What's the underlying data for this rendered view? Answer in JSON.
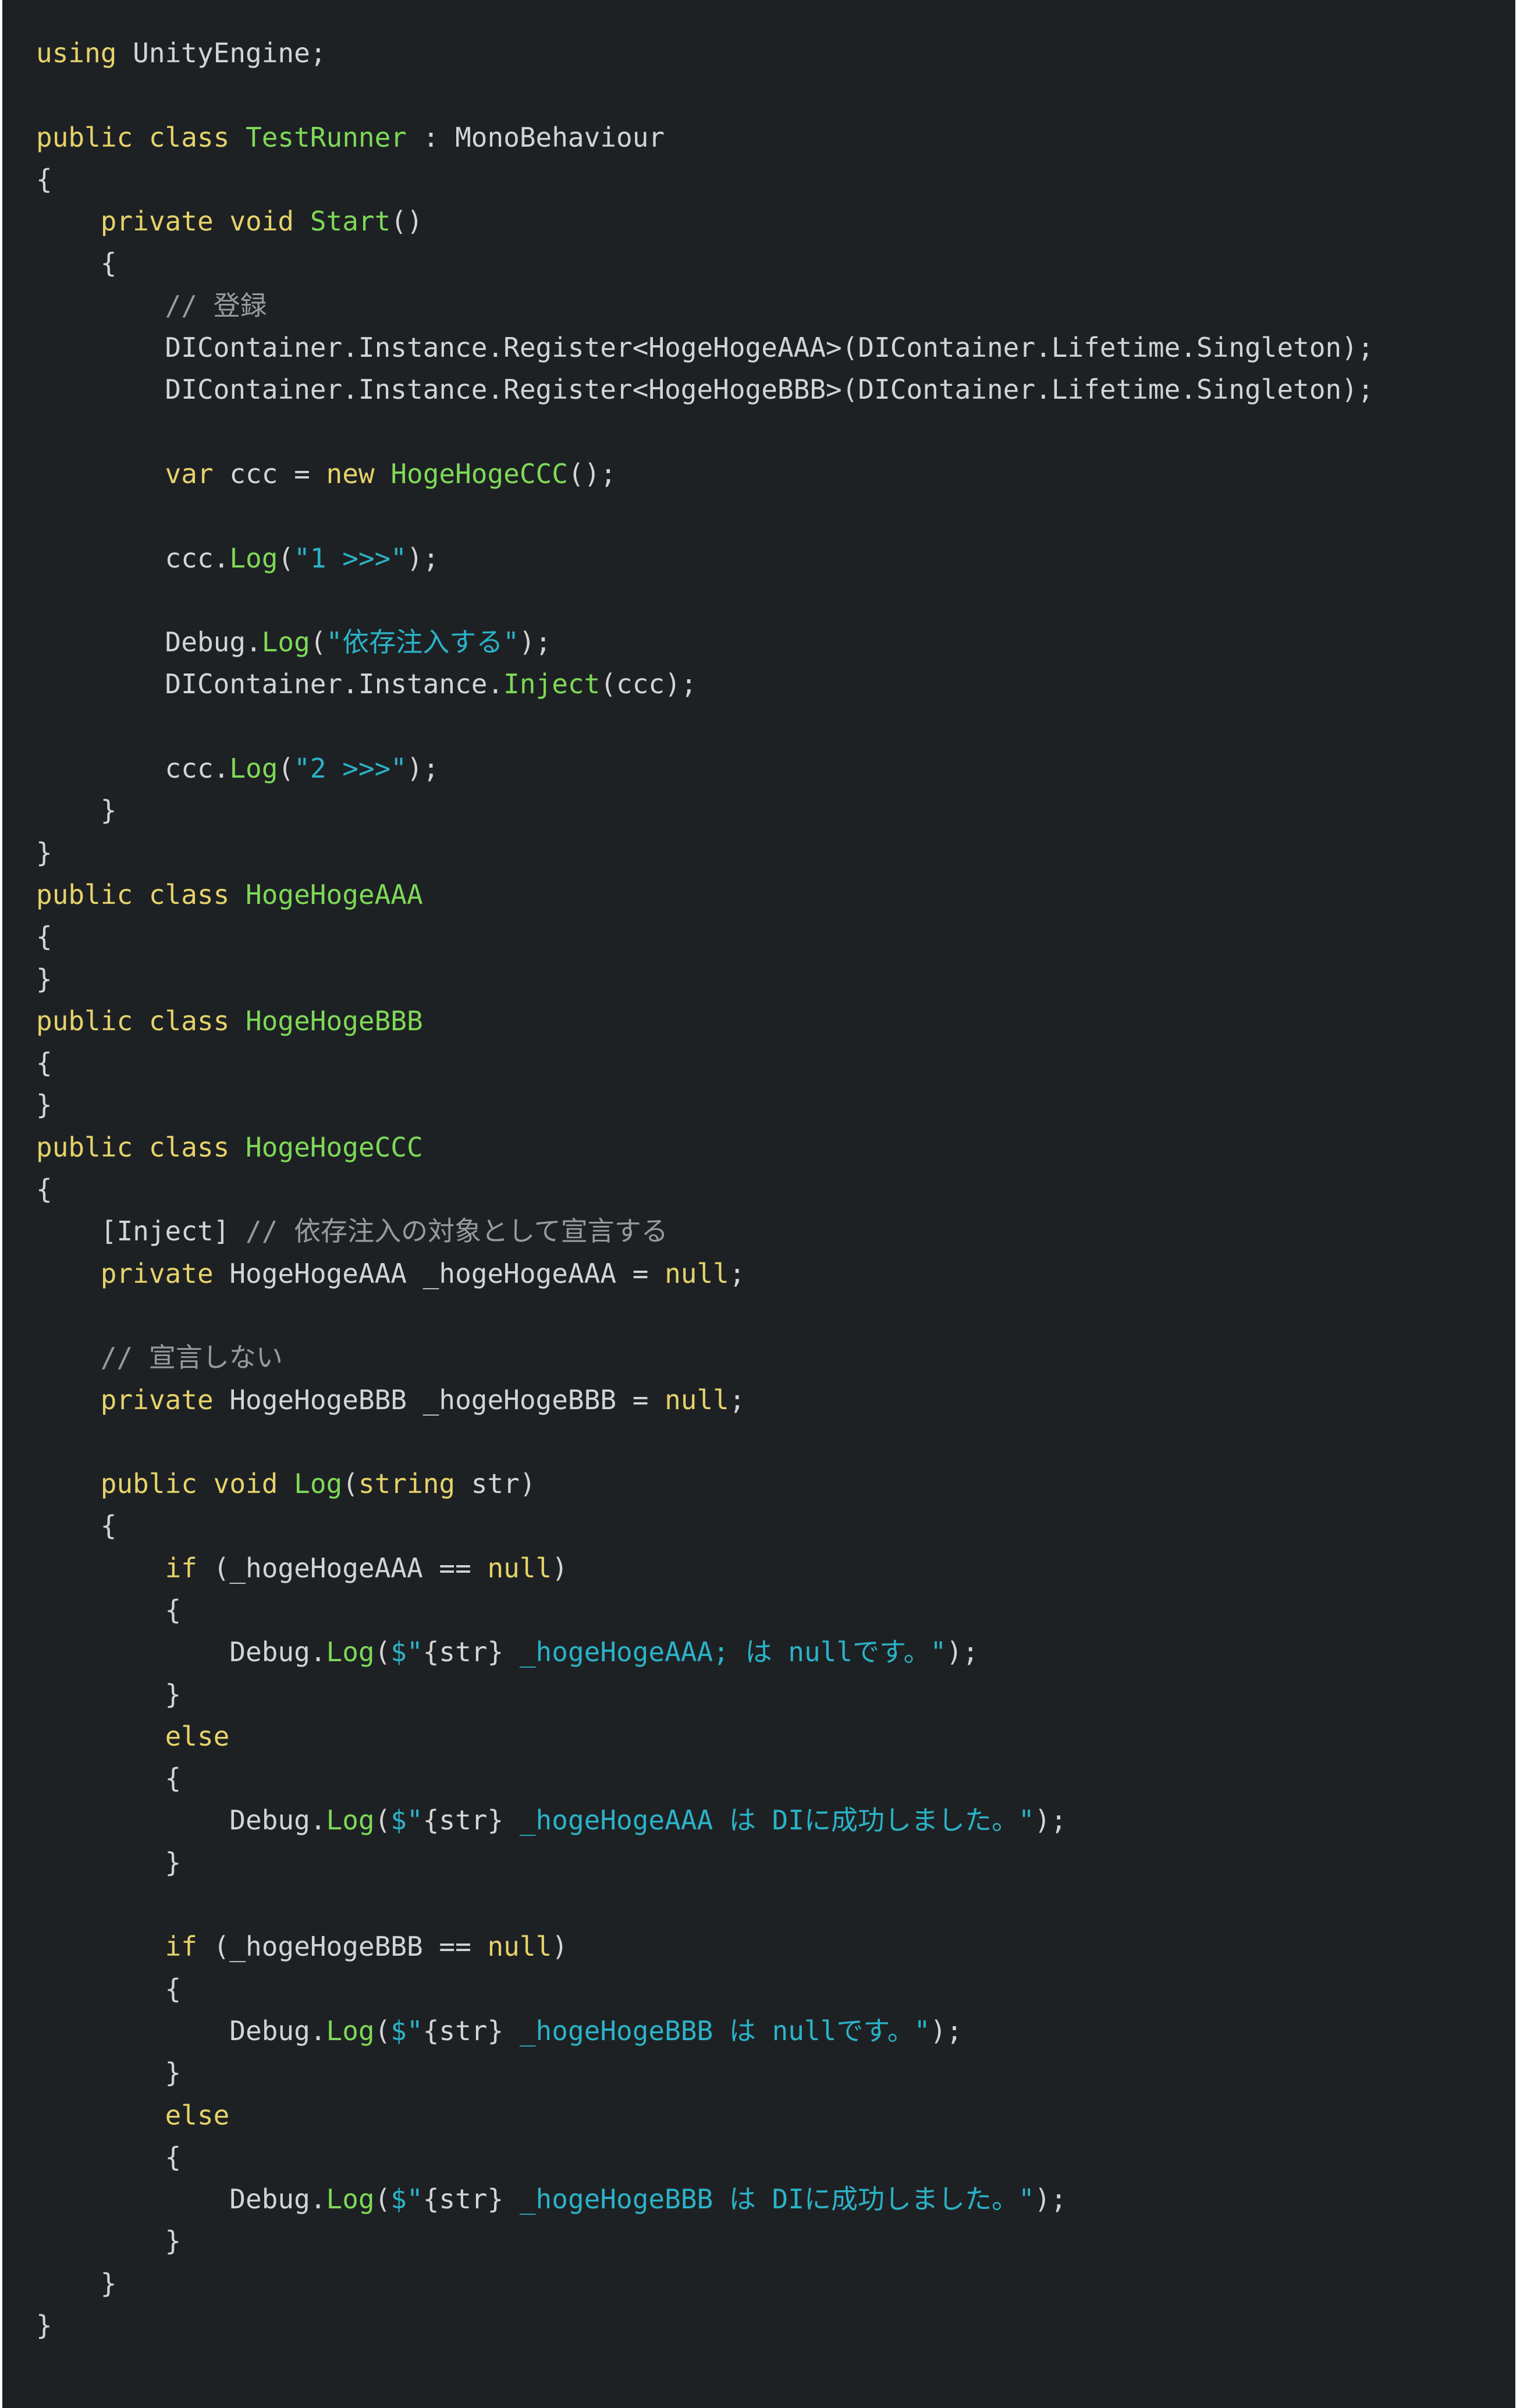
{
  "colors": {
    "background": "#1e2124",
    "keyword": "#e6d36a",
    "type": "#7ed957",
    "method": "#7ed957",
    "string": "#2bb3c7",
    "comment": "#9a9a9a",
    "plain": "#d4d4d4"
  },
  "code": {
    "lines": [
      [
        {
          "t": "using",
          "c": "keyword"
        },
        {
          "t": " UnityEngine;",
          "c": "plain"
        }
      ],
      [],
      [
        {
          "t": "public class ",
          "c": "keyword"
        },
        {
          "t": "TestRunner",
          "c": "type"
        },
        {
          "t": " : MonoBehaviour",
          "c": "plain"
        }
      ],
      [
        {
          "t": "{",
          "c": "plain"
        }
      ],
      [
        {
          "t": "    ",
          "c": "plain"
        },
        {
          "t": "private void ",
          "c": "keyword"
        },
        {
          "t": "Start",
          "c": "method"
        },
        {
          "t": "()",
          "c": "plain"
        }
      ],
      [
        {
          "t": "    {",
          "c": "plain"
        }
      ],
      [
        {
          "t": "        ",
          "c": "plain"
        },
        {
          "t": "// 登録",
          "c": "comment"
        }
      ],
      [
        {
          "t": "        DIContainer.Instance.Register<HogeHogeAAA>(DIContainer.Lifetime.Singleton);",
          "c": "plain"
        }
      ],
      [
        {
          "t": "        DIContainer.Instance.Register<HogeHogeBBB>(DIContainer.Lifetime.Singleton);",
          "c": "plain"
        }
      ],
      [],
      [
        {
          "t": "        ",
          "c": "plain"
        },
        {
          "t": "var",
          "c": "keyword"
        },
        {
          "t": " ccc = ",
          "c": "plain"
        },
        {
          "t": "new ",
          "c": "keyword"
        },
        {
          "t": "HogeHogeCCC",
          "c": "type"
        },
        {
          "t": "();",
          "c": "plain"
        }
      ],
      [],
      [
        {
          "t": "        ccc.",
          "c": "plain"
        },
        {
          "t": "Log",
          "c": "method"
        },
        {
          "t": "(",
          "c": "plain"
        },
        {
          "t": "\"1 >>>\"",
          "c": "string"
        },
        {
          "t": ");",
          "c": "plain"
        }
      ],
      [],
      [
        {
          "t": "        Debug.",
          "c": "plain"
        },
        {
          "t": "Log",
          "c": "method"
        },
        {
          "t": "(",
          "c": "plain"
        },
        {
          "t": "\"依存注入する\"",
          "c": "string"
        },
        {
          "t": ");",
          "c": "plain"
        }
      ],
      [
        {
          "t": "        DIContainer.Instance.",
          "c": "plain"
        },
        {
          "t": "Inject",
          "c": "method"
        },
        {
          "t": "(ccc);",
          "c": "plain"
        }
      ],
      [],
      [
        {
          "t": "        ccc.",
          "c": "plain"
        },
        {
          "t": "Log",
          "c": "method"
        },
        {
          "t": "(",
          "c": "plain"
        },
        {
          "t": "\"2 >>>\"",
          "c": "string"
        },
        {
          "t": ");",
          "c": "plain"
        }
      ],
      [
        {
          "t": "    }",
          "c": "plain"
        }
      ],
      [
        {
          "t": "}",
          "c": "plain"
        }
      ],
      [
        {
          "t": "public class ",
          "c": "keyword"
        },
        {
          "t": "HogeHogeAAA",
          "c": "type"
        }
      ],
      [
        {
          "t": "{",
          "c": "plain"
        }
      ],
      [
        {
          "t": "}",
          "c": "plain"
        }
      ],
      [
        {
          "t": "public class ",
          "c": "keyword"
        },
        {
          "t": "HogeHogeBBB",
          "c": "type"
        }
      ],
      [
        {
          "t": "{",
          "c": "plain"
        }
      ],
      [
        {
          "t": "}",
          "c": "plain"
        }
      ],
      [
        {
          "t": "public class ",
          "c": "keyword"
        },
        {
          "t": "HogeHogeCCC",
          "c": "type"
        }
      ],
      [
        {
          "t": "{",
          "c": "plain"
        }
      ],
      [
        {
          "t": "    [Inject] ",
          "c": "plain"
        },
        {
          "t": "// 依存注入の対象として宣言する",
          "c": "comment"
        }
      ],
      [
        {
          "t": "    ",
          "c": "plain"
        },
        {
          "t": "private ",
          "c": "keyword"
        },
        {
          "t": "HogeHogeAAA _hogeHogeAAA = ",
          "c": "plain"
        },
        {
          "t": "null",
          "c": "keyword"
        },
        {
          "t": ";",
          "c": "plain"
        }
      ],
      [],
      [
        {
          "t": "    ",
          "c": "plain"
        },
        {
          "t": "// 宣言しない",
          "c": "comment"
        }
      ],
      [
        {
          "t": "    ",
          "c": "plain"
        },
        {
          "t": "private ",
          "c": "keyword"
        },
        {
          "t": "HogeHogeBBB _hogeHogeBBB = ",
          "c": "plain"
        },
        {
          "t": "null",
          "c": "keyword"
        },
        {
          "t": ";",
          "c": "plain"
        }
      ],
      [],
      [
        {
          "t": "    ",
          "c": "plain"
        },
        {
          "t": "public void ",
          "c": "keyword"
        },
        {
          "t": "Log",
          "c": "method"
        },
        {
          "t": "(",
          "c": "plain"
        },
        {
          "t": "string",
          "c": "keyword"
        },
        {
          "t": " str)",
          "c": "plain"
        }
      ],
      [
        {
          "t": "    {",
          "c": "plain"
        }
      ],
      [
        {
          "t": "        ",
          "c": "plain"
        },
        {
          "t": "if",
          "c": "keyword"
        },
        {
          "t": " (_hogeHogeAAA == ",
          "c": "plain"
        },
        {
          "t": "null",
          "c": "keyword"
        },
        {
          "t": ")",
          "c": "plain"
        }
      ],
      [
        {
          "t": "        {",
          "c": "plain"
        }
      ],
      [
        {
          "t": "            Debug.",
          "c": "plain"
        },
        {
          "t": "Log",
          "c": "method"
        },
        {
          "t": "(",
          "c": "plain"
        },
        {
          "t": "$\"",
          "c": "string"
        },
        {
          "t": "{str}",
          "c": "plain"
        },
        {
          "t": " _hogeHogeAAA; は nullです。\"",
          "c": "string"
        },
        {
          "t": ");",
          "c": "plain"
        }
      ],
      [
        {
          "t": "        }",
          "c": "plain"
        }
      ],
      [
        {
          "t": "        ",
          "c": "plain"
        },
        {
          "t": "else",
          "c": "keyword"
        }
      ],
      [
        {
          "t": "        {",
          "c": "plain"
        }
      ],
      [
        {
          "t": "            Debug.",
          "c": "plain"
        },
        {
          "t": "Log",
          "c": "method"
        },
        {
          "t": "(",
          "c": "plain"
        },
        {
          "t": "$\"",
          "c": "string"
        },
        {
          "t": "{str}",
          "c": "plain"
        },
        {
          "t": " _hogeHogeAAA は DIに成功しました。\"",
          "c": "string"
        },
        {
          "t": ");",
          "c": "plain"
        }
      ],
      [
        {
          "t": "        }",
          "c": "plain"
        }
      ],
      [],
      [
        {
          "t": "        ",
          "c": "plain"
        },
        {
          "t": "if",
          "c": "keyword"
        },
        {
          "t": " (_hogeHogeBBB == ",
          "c": "plain"
        },
        {
          "t": "null",
          "c": "keyword"
        },
        {
          "t": ")",
          "c": "plain"
        }
      ],
      [
        {
          "t": "        {",
          "c": "plain"
        }
      ],
      [
        {
          "t": "            Debug.",
          "c": "plain"
        },
        {
          "t": "Log",
          "c": "method"
        },
        {
          "t": "(",
          "c": "plain"
        },
        {
          "t": "$\"",
          "c": "string"
        },
        {
          "t": "{str}",
          "c": "plain"
        },
        {
          "t": " _hogeHogeBBB は nullです。\"",
          "c": "string"
        },
        {
          "t": ");",
          "c": "plain"
        }
      ],
      [
        {
          "t": "        }",
          "c": "plain"
        }
      ],
      [
        {
          "t": "        ",
          "c": "plain"
        },
        {
          "t": "else",
          "c": "keyword"
        }
      ],
      [
        {
          "t": "        {",
          "c": "plain"
        }
      ],
      [
        {
          "t": "            Debug.",
          "c": "plain"
        },
        {
          "t": "Log",
          "c": "method"
        },
        {
          "t": "(",
          "c": "plain"
        },
        {
          "t": "$\"",
          "c": "string"
        },
        {
          "t": "{str}",
          "c": "plain"
        },
        {
          "t": " _hogeHogeBBB は DIに成功しました。\"",
          "c": "string"
        },
        {
          "t": ");",
          "c": "plain"
        }
      ],
      [
        {
          "t": "        }",
          "c": "plain"
        }
      ],
      [
        {
          "t": "    }",
          "c": "plain"
        }
      ],
      [
        {
          "t": "}",
          "c": "plain"
        }
      ]
    ]
  }
}
